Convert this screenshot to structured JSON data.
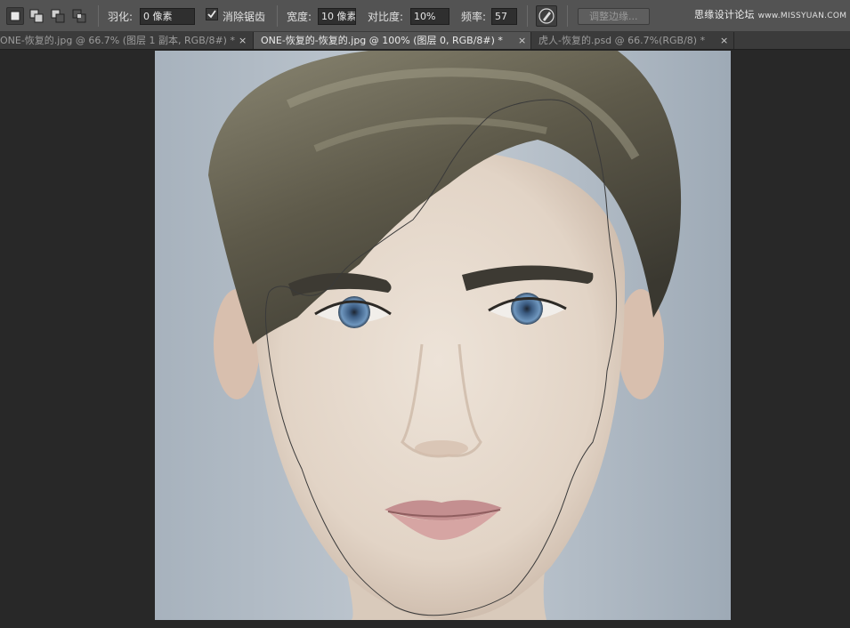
{
  "options_bar": {
    "feather_label": "羽化:",
    "feather_value": "0 像素",
    "antialias_label": "消除锯齿",
    "antialias_checked": true,
    "width_label": "宽度:",
    "width_value": "10 像素",
    "contrast_label": "对比度:",
    "contrast_value": "10%",
    "frequency_label": "频率:",
    "frequency_value": "57",
    "refine_edge_label": "调整边缘...",
    "watermark_cn": "思缘设计论坛",
    "watermark_en": "www.MISSYUAN.COM"
  },
  "tabs": [
    {
      "label": "ONE-恢复的.jpg @ 66.7% (图层 1 副本, RGB/8#) *",
      "active": false,
      "close": "×"
    },
    {
      "label": "ONE-恢复的-恢复的.jpg @ 100% (图层 0, RGB/8#) *",
      "active": true,
      "close": "×"
    },
    {
      "label": "虎人-恢复的.psd @ 66.7%(RGB/8) *",
      "active": false,
      "close": "×"
    }
  ],
  "tool": {
    "name": "magnetic-lasso",
    "active_selection_mode": "new-selection",
    "selection_modes": [
      "new-selection",
      "add-to-selection",
      "subtract-from-selection",
      "intersect-with-selection"
    ]
  },
  "colors": {
    "panel": "#535353",
    "canvas_bg": "#282828",
    "tab_inactive": "#3b3b3b",
    "photo_bg": "#b7c0c9",
    "hair": "#5d5a4c",
    "skin": "#e4d8cb",
    "iris": "#5c86b0",
    "lips": "#c08c8e",
    "lasso_path": "#3a3a3a"
  }
}
